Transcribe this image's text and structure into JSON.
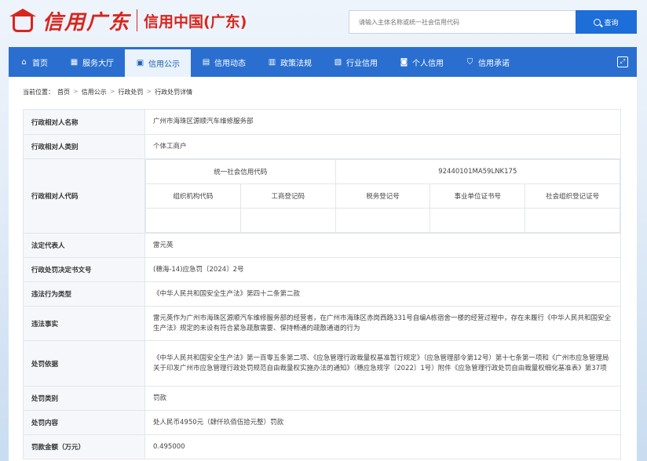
{
  "header": {
    "logo_text": "信用广东",
    "site_name": "信用中国(广东)",
    "search_placeholder": "请输入主体名称或统一社会信用代码",
    "search_button": "查询"
  },
  "nav": [
    {
      "label": "首页",
      "icon": "home-icon",
      "glyph": "⌂"
    },
    {
      "label": "服务大厅",
      "icon": "grid-icon",
      "glyph": "▦"
    },
    {
      "label": "信用公示",
      "icon": "badge-icon",
      "glyph": "▣",
      "active": true
    },
    {
      "label": "信用动态",
      "icon": "list-icon",
      "glyph": "▤"
    },
    {
      "label": "政策法规",
      "icon": "book-icon",
      "glyph": "▥"
    },
    {
      "label": "行业信用",
      "icon": "briefcase-icon",
      "glyph": "▧"
    },
    {
      "label": "个人信用",
      "icon": "person-icon",
      "glyph": "◙"
    },
    {
      "label": "信用承诺",
      "icon": "shield-icon",
      "glyph": "⛉"
    }
  ],
  "breadcrumb": {
    "prefix": "当前位置：",
    "items": [
      "首页",
      "信用公示",
      "行政处罚",
      "行政处罚详情"
    ]
  },
  "detail": {
    "name_label": "行政相对人名称",
    "name_value": "广州市海珠区源顺汽车维修服务部",
    "type_label": "行政相对人类别",
    "type_value": "个体工商户",
    "code_label": "行政相对人代码",
    "uscc_label": "统一社会信用代码",
    "uscc_value": "92440101MA59LNK175",
    "code_headers": [
      "组织机构代码",
      "工商登记码",
      "税务登记号",
      "事业单位证书号",
      "社会组织登记证号"
    ],
    "legal_label": "法定代表人",
    "legal_value": "雷元英",
    "doc_label": "行政处罚决定书文号",
    "doc_value": "(穗海-14)应急罚〔2024〕2号",
    "violation_type_label": "违法行为类型",
    "violation_type_value": "《中华人民共和国安全生产法》第四十二条第二款",
    "facts_label": "违法事实",
    "facts_value": "雷元英作为广州市海珠区源顺汽车维修服务部的经营者，在广州市海珠区赤岗西路331号自编A栋宿舍一楼的经营过程中，存在未履行《中华人民共和国安全生产法》规定的未设有符合紧急疏散需要、保持畅通的疏散通道的行为",
    "basis_label": "处罚依据",
    "basis_value": "《中华人民共和国安全生产法》第一百零五条第二项、《应急管理行政裁量权基准暂行规定》（应急管理部令第12号）第十七条第一项和《广州市应急管理局关于印发广州市应急管理行政处罚规范自由裁量权实施办法的通知》（穗应急规字〔2022〕1号）附件《应急管理行政处罚自由裁量权细化基准表》第37项",
    "category_label": "处罚类别",
    "category_value": "罚款",
    "content_label": "处罚内容",
    "content_value": "处人民币4950元（肆仟玖佰伍拾元整）罚款",
    "amount_label": "罚款金额（万元）",
    "amount_value": "0.495000"
  }
}
